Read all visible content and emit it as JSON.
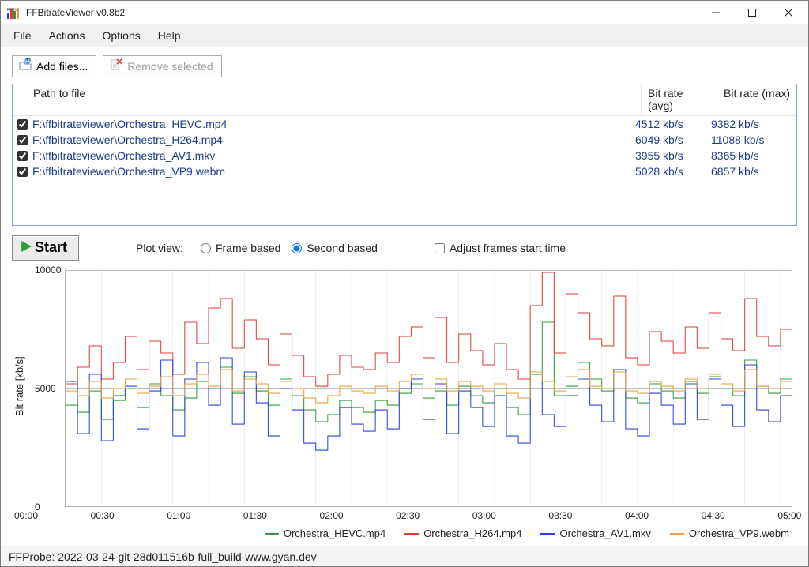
{
  "window": {
    "title": "FFBitrateViewer v0.8b2"
  },
  "menu": {
    "items": [
      "File",
      "Actions",
      "Options",
      "Help"
    ]
  },
  "toolbar": {
    "add_files_label": "Add files...",
    "remove_selected_label": "Remove selected"
  },
  "file_table": {
    "headers": {
      "path": "Path to file",
      "avg": "Bit rate (avg)",
      "max": "Bit rate (max)"
    },
    "rows": [
      {
        "checked": true,
        "path": "F:\\ffbitrateviewer\\Orchestra_HEVC.mp4",
        "avg": "4512 kb/s",
        "max": "9382 kb/s"
      },
      {
        "checked": true,
        "path": "F:\\ffbitrateviewer\\Orchestra_H264.mp4",
        "avg": "6049 kb/s",
        "max": "11088 kb/s"
      },
      {
        "checked": true,
        "path": "F:\\ffbitrateviewer\\Orchestra_AV1.mkv",
        "avg": "3955 kb/s",
        "max": "8365 kb/s"
      },
      {
        "checked": true,
        "path": "F:\\ffbitrateviewer\\Orchestra_VP9.webm",
        "avg": "5028 kb/s",
        "max": "6857 kb/s"
      }
    ]
  },
  "controls": {
    "start_label": "Start",
    "plot_view_label": "Plot view:",
    "frame_based_label": "Frame based",
    "second_based_label": "Second based",
    "plot_view_selected": "second",
    "adjust_label": "Adjust frames start time",
    "adjust_checked": false
  },
  "status": {
    "text": "FFProbe: 2022-03-24-git-28d011516b-full_build-www.gyan.dev"
  },
  "colors": {
    "hevc": "#2e9c3a",
    "h264": "#e03a3a",
    "av1": "#2b3fe0",
    "vp9": "#e6a23c",
    "grid": "#e0e4ea",
    "axis": "#555"
  },
  "chart_data": {
    "type": "line",
    "title": "",
    "xlabel": "",
    "ylabel": "Bit rate [kb/s]",
    "ylim": [
      0,
      10000
    ],
    "yticks": [
      0,
      5000,
      10000
    ],
    "xticks": [
      "00:00",
      "00:30",
      "01:00",
      "01:30",
      "02:00",
      "02:30",
      "03:00",
      "03:30",
      "04:00",
      "04:30",
      "05:00"
    ],
    "x_range_seconds": [
      0,
      310
    ],
    "x_step_seconds": 10,
    "series": [
      {
        "name": "Orchestra_HEVC.mp4",
        "color_key": "hevc",
        "values": [
          4300,
          4000,
          4900,
          3700,
          4500,
          5000,
          4200,
          5200,
          4700,
          4100,
          4600,
          5300,
          5000,
          5900,
          4800,
          5500,
          4900,
          4300,
          5400,
          4700,
          4100,
          3600,
          3900,
          4500,
          4200,
          4000,
          4500,
          4300,
          4800,
          5200,
          4600,
          4900,
          4300,
          5100,
          4700,
          4400,
          5000,
          4200,
          3900,
          5600,
          7800,
          4700,
          5100,
          6100,
          5400,
          4900,
          5800,
          4600,
          4400,
          5200,
          4900,
          4600,
          5300,
          4800,
          5500,
          5000,
          4700,
          6200,
          5100,
          4800,
          5400,
          4900
        ]
      },
      {
        "name": "Orchestra_H264.mp4",
        "color_key": "h264",
        "values": [
          5200,
          5900,
          6800,
          5400,
          6100,
          7200,
          5800,
          7000,
          6500,
          5600,
          7800,
          6900,
          8400,
          8800,
          6700,
          7900,
          7100,
          6000,
          7300,
          6400,
          5500,
          5100,
          5600,
          6400,
          5900,
          5800,
          6500,
          6100,
          7200,
          7600,
          6300,
          8000,
          6100,
          7300,
          6600,
          6000,
          6900,
          5800,
          5400,
          8500,
          9900,
          6500,
          9000,
          8200,
          7100,
          6800,
          8900,
          6300,
          6000,
          7400,
          7000,
          6500,
          7600,
          6700,
          8200,
          7100,
          6600,
          8800,
          7200,
          6800,
          7500,
          6900
        ]
      },
      {
        "name": "Orchestra_AV1.mkv",
        "color_key": "av1",
        "values": [
          5300,
          3100,
          5600,
          2800,
          4700,
          5100,
          3300,
          4900,
          6200,
          3000,
          5400,
          6100,
          4300,
          6300,
          3500,
          5700,
          4400,
          3000,
          5000,
          4100,
          2700,
          2400,
          3000,
          4200,
          3500,
          3200,
          4100,
          3300,
          5000,
          5400,
          3700,
          5200,
          3100,
          4900,
          4200,
          3400,
          4700,
          3000,
          2700,
          5700,
          3900,
          3400,
          4700,
          5400,
          4300,
          3600,
          5800,
          3300,
          3000,
          4800,
          4300,
          3500,
          5200,
          3700,
          5400,
          4300,
          3400,
          6000,
          4100,
          3600,
          4700,
          4000
        ]
      },
      {
        "name": "Orchestra_VP9.webm",
        "color_key": "vp9",
        "values": [
          4900,
          4700,
          5300,
          4600,
          5000,
          5400,
          4800,
          5100,
          5500,
          4700,
          5200,
          5600,
          5100,
          5800,
          4900,
          5400,
          5200,
          4800,
          5300,
          5000,
          4600,
          4400,
          4700,
          5100,
          4900,
          4800,
          5100,
          4900,
          5300,
          5600,
          5000,
          5400,
          4900,
          5300,
          5100,
          4900,
          5200,
          4800,
          4600,
          5700,
          5300,
          4900,
          5500,
          5800,
          5100,
          5000,
          5700,
          4900,
          4800,
          5300,
          5100,
          4900,
          5400,
          5000,
          5600,
          5200,
          4900,
          5800,
          5100,
          5000,
          5300,
          5100
        ]
      }
    ],
    "legend_position": "bottom"
  }
}
